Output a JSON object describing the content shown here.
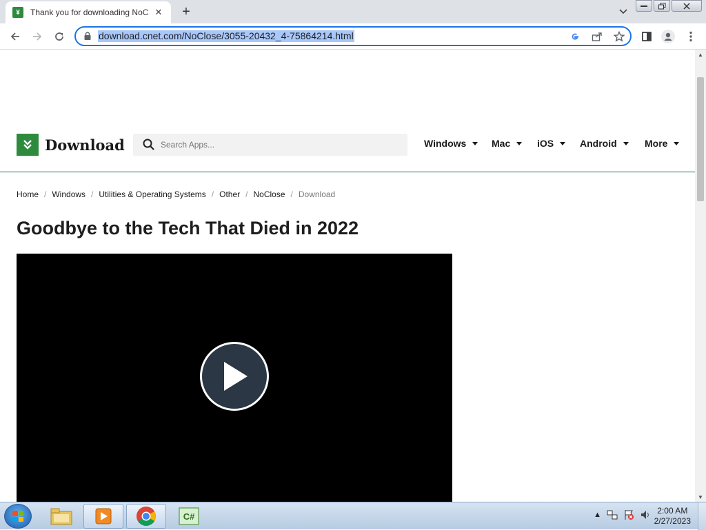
{
  "browser": {
    "tab_title": "Thank you for downloading NoClose",
    "new_tab_label": "+",
    "url": "download.cnet.com/NoClose/3055-20432_4-75864214.html"
  },
  "site": {
    "logo_text": "Download",
    "search_placeholder": "Search Apps...",
    "nav": [
      {
        "label": "Windows"
      },
      {
        "label": "Mac"
      },
      {
        "label": "iOS"
      },
      {
        "label": "Android"
      },
      {
        "label": "More"
      }
    ],
    "breadcrumb": [
      "Home",
      "Windows",
      "Utilities & Operating Systems",
      "Other",
      "NoClose",
      "Download"
    ],
    "headline": "Goodbye to the Tech That Died in 2022"
  },
  "taskbar": {
    "time": "2:00 AM",
    "date": "2/27/2023",
    "apps": [
      "file-explorer",
      "media-player",
      "chrome",
      "csharp-ide"
    ]
  },
  "colors": {
    "brand_green": "#2e8b3d",
    "omnibox_focus": "#1a73e8",
    "url_selection": "#a8c7fa"
  }
}
